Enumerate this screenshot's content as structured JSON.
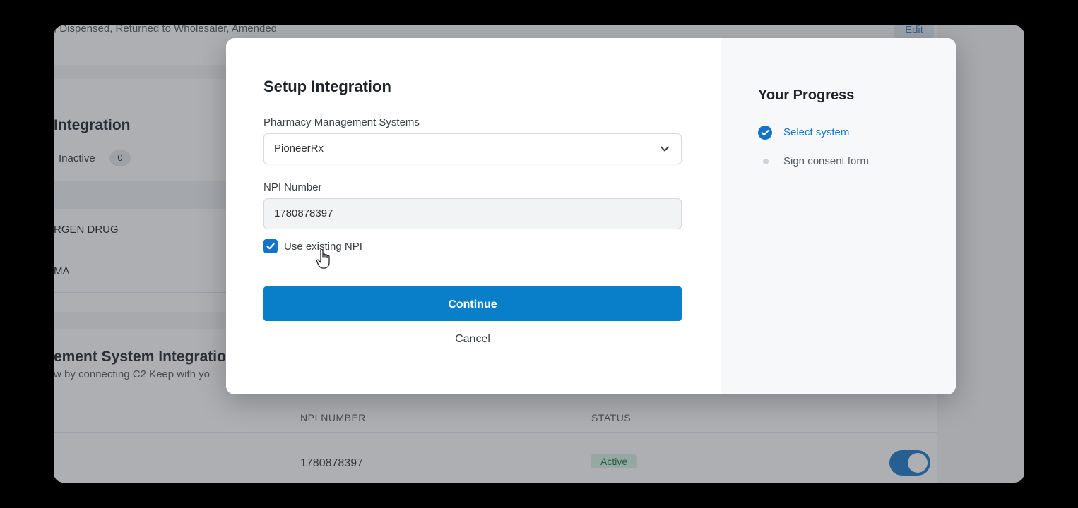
{
  "background": {
    "top_text": ", Dispensed, Returned to Wholesaler, Amended",
    "edit_label": "Edit",
    "card1": {
      "heading": "Integration",
      "inactive_label": "Inactive",
      "inactive_count": "0",
      "rows": [
        "RGEN DRUG",
        "MA"
      ]
    },
    "card2": {
      "heading": "ement System Integration",
      "subtext": "w by connecting C2 Keep with yo",
      "columns": {
        "npi": "NPI NUMBER",
        "status": "STATUS"
      },
      "row": {
        "npi": "1780878397",
        "status": "Active",
        "toggle_on": true
      }
    }
  },
  "modal": {
    "title": "Setup Integration",
    "pms_label": "Pharmacy Management Systems",
    "pms_value": "PioneerRx",
    "npi_label": "NPI Number",
    "npi_value": "1780878397",
    "use_existing_label": "Use existing NPI",
    "use_existing_checked": true,
    "continue_label": "Continue",
    "cancel_label": "Cancel"
  },
  "progress": {
    "title": "Your Progress",
    "steps": [
      {
        "label": "Select system",
        "state": "done"
      },
      {
        "label": "Sign consent form",
        "state": "pending"
      }
    ]
  },
  "colors": {
    "accent": "#0a7fc9",
    "active_badge": "#d8f3e3"
  }
}
